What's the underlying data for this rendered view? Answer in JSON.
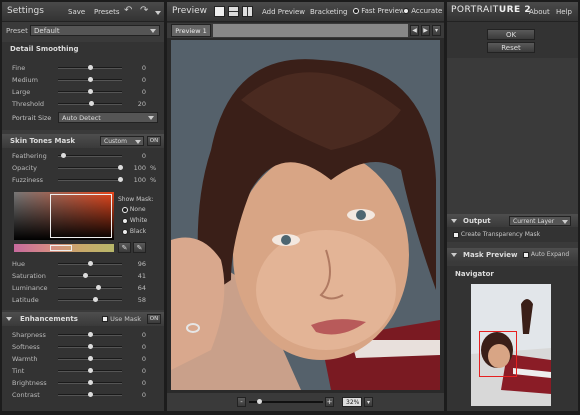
{
  "settings": {
    "title": "Settings",
    "save": "Save",
    "presets": "Presets",
    "preset_label": "Preset",
    "preset_value": "Default"
  },
  "detail": {
    "title": "Detail Smoothing",
    "sliders": [
      {
        "label": "Fine",
        "value": "0",
        "pos": 0.5
      },
      {
        "label": "Medium",
        "value": "0",
        "pos": 0.5
      },
      {
        "label": "Large",
        "value": "0",
        "pos": 0.5
      },
      {
        "label": "Threshold",
        "value": "20",
        "pos": 0.52
      }
    ],
    "portrait_size_label": "Portrait Size",
    "portrait_size_value": "Auto Detect"
  },
  "skin": {
    "title": "Skin Tones Mask",
    "mode": "Custom",
    "on": "ON",
    "sliders": [
      {
        "label": "Feathering",
        "value": "0",
        "pct": ""
      },
      {
        "label": "Opacity",
        "value": "100",
        "pct": "%"
      },
      {
        "label": "Fuzziness",
        "value": "100",
        "pct": "%"
      }
    ],
    "show_mask": "Show Mask:",
    "mask_options": [
      "None",
      "White",
      "Black"
    ],
    "hsl": [
      {
        "label": "Hue",
        "value": "96",
        "pos": 0.5
      },
      {
        "label": "Saturation",
        "value": "41",
        "pos": 0.42
      },
      {
        "label": "Luminance",
        "value": "64",
        "pos": 0.64
      },
      {
        "label": "Latitude",
        "value": "58",
        "pos": 0.58
      }
    ]
  },
  "enh": {
    "title": "Enhancements",
    "use_mask": "Use Mask",
    "on": "ON",
    "sliders": [
      {
        "label": "Sharpness",
        "value": "0"
      },
      {
        "label": "Softness",
        "value": "0"
      },
      {
        "label": "Warmth",
        "value": "0"
      },
      {
        "label": "Tint",
        "value": "0"
      },
      {
        "label": "Brightness",
        "value": "0"
      },
      {
        "label": "Contrast",
        "value": "0"
      }
    ]
  },
  "preview": {
    "title": "Preview",
    "add": "Add Preview",
    "bracketing": "Bracketing",
    "fast": "Fast Preview",
    "accurate": "Accurate",
    "tab": "Preview 1",
    "zoom": "32%"
  },
  "right": {
    "brand_a": "PORTRAIT",
    "brand_b": "URE 2",
    "about": "About",
    "help": "Help",
    "ok": "OK",
    "reset": "Reset",
    "output": "Output",
    "current_layer": "Current Layer",
    "create_transparency": "Create Transparency Mask",
    "mask_preview": "Mask Preview",
    "auto_expand": "Auto Expand",
    "navigator": "Navigator"
  }
}
